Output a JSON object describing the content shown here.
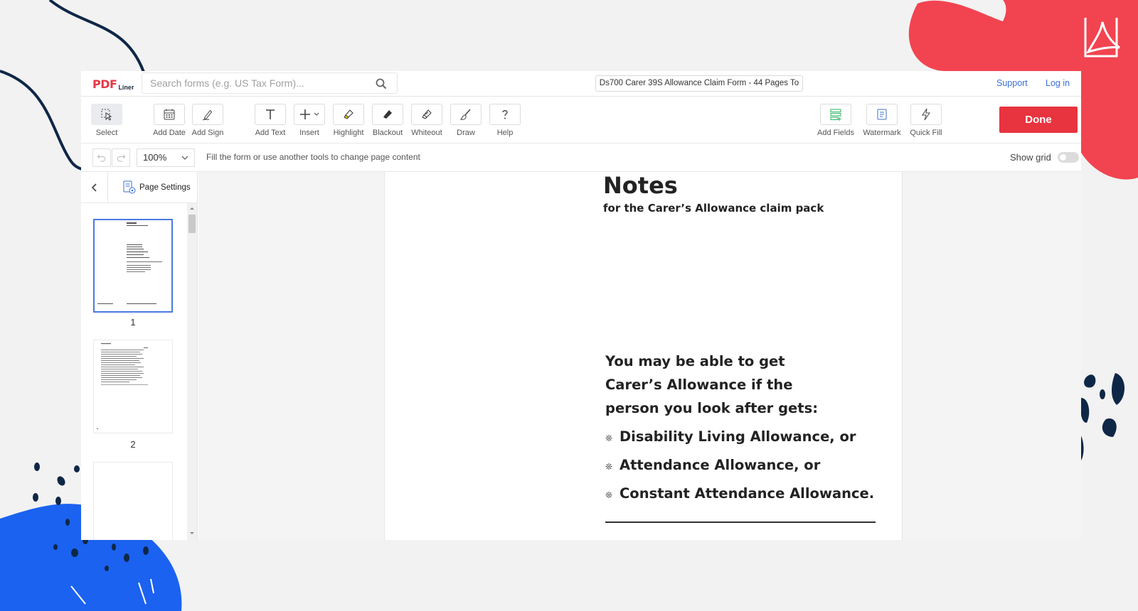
{
  "app": {
    "logo_main": "PDF",
    "logo_sub": "Liner",
    "search_placeholder": "Search forms (e.g. US Tax Form)...",
    "document_title": "Ds700 Carer 39S Allowance Claim Form - 44 Pages To",
    "links": {
      "support": "Support",
      "login": "Log in"
    }
  },
  "toolbar": {
    "tools": [
      {
        "label": "Select",
        "icon": "select-cursor-icon"
      },
      {
        "label": "Add Date",
        "icon": "calendar-icon"
      },
      {
        "label": "Add Sign",
        "icon": "signature-pen-icon"
      },
      {
        "label": "Add Text",
        "icon": "text-t-icon"
      },
      {
        "label": "Insert",
        "icon": "plus-icon"
      },
      {
        "label": "Highlight",
        "icon": "highlighter-icon"
      },
      {
        "label": "Blackout",
        "icon": "blackout-marker-icon"
      },
      {
        "label": "Whiteout",
        "icon": "whiteout-marker-icon"
      },
      {
        "label": "Draw",
        "icon": "brush-icon"
      },
      {
        "label": "Help",
        "icon": "question-icon"
      }
    ],
    "right_tools": [
      {
        "label": "Add Fields",
        "icon": "fields-icon"
      },
      {
        "label": "Watermark",
        "icon": "watermark-icon"
      },
      {
        "label": "Quick Fill",
        "icon": "lightning-icon"
      }
    ],
    "done_label": "Done"
  },
  "subbar": {
    "zoom": "100%",
    "hint": "Fill the form or use another tools to change page content",
    "show_grid_label": "Show grid",
    "show_grid": false
  },
  "sidebar": {
    "page_settings_label": "Page Settings",
    "pages": [
      "1",
      "2"
    ],
    "selected_page": "1"
  },
  "document": {
    "heading": "Notes",
    "subheading": "for the Carer’s Allowance claim pack",
    "intro_lines": [
      "You may be able to get",
      "Carer’s Allowance if the",
      "person you look after gets:"
    ],
    "bullets": [
      "Disability Living Allowance, or",
      "Attendance Allowance, or",
      "Constant Attendance Allowance."
    ]
  },
  "colors": {
    "accent_red": "#e8343f",
    "link_blue": "#3b6fd4",
    "deco_navy": "#0f2747",
    "deco_blue": "#1b62f0",
    "deco_red": "#f24450"
  }
}
